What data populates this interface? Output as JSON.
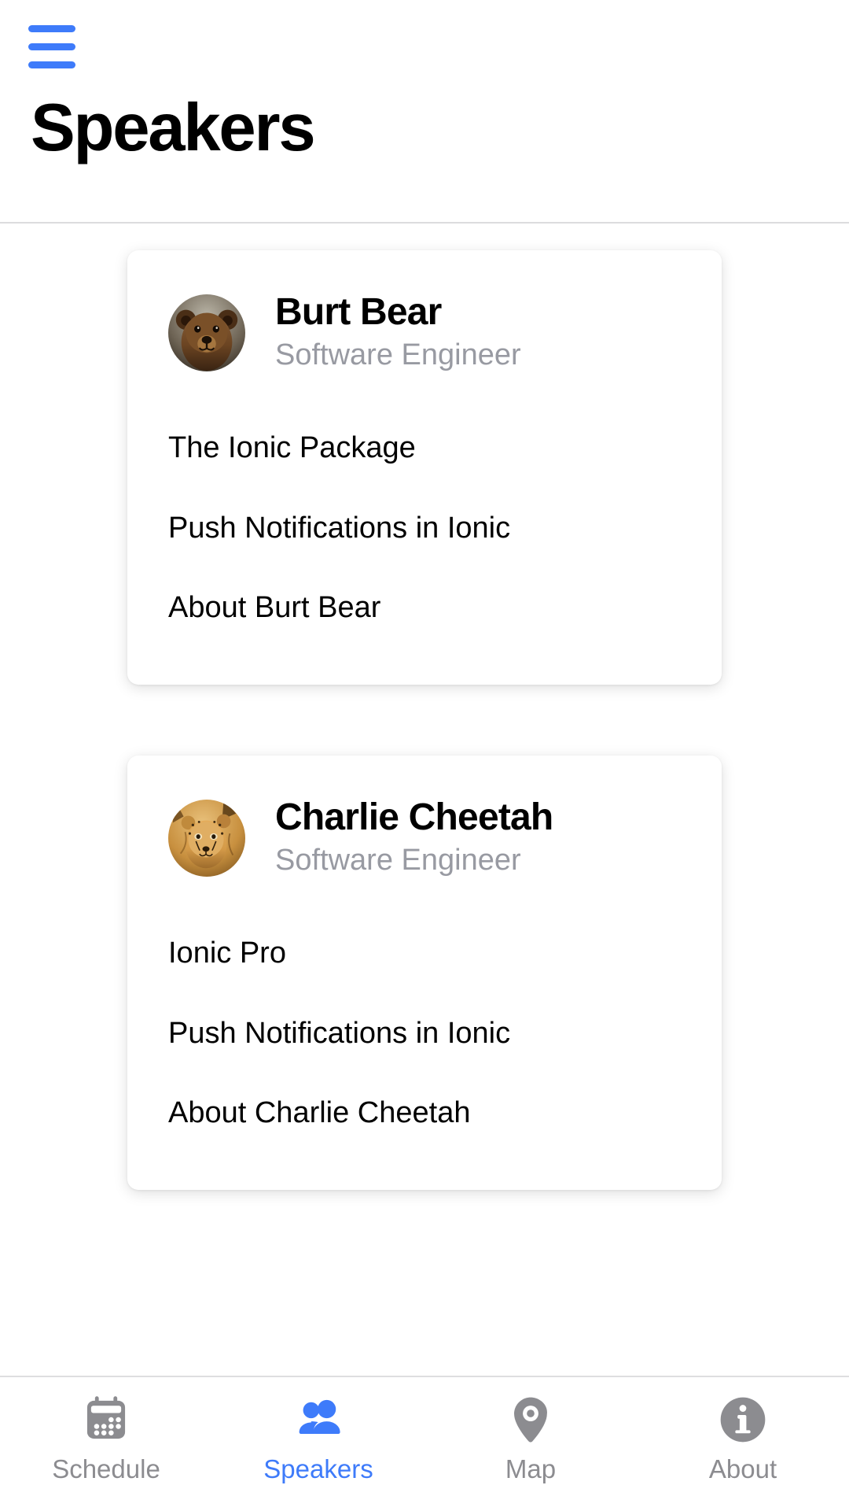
{
  "header": {
    "menu_icon": "hamburger-menu-icon",
    "title": "Speakers"
  },
  "theme": {
    "accent": "#3e7bfa",
    "inactive": "#8c8c90",
    "subtitle": "#989aa2",
    "text": "#000000",
    "card_bg": "#ffffff",
    "page_bg": "#ffffff"
  },
  "speakers": [
    {
      "name": "Burt Bear",
      "title": "Software Engineer",
      "avatar": "bear-avatar",
      "sessions": [
        "The Ionic Package",
        "Push Notifications in Ionic",
        "About Burt Bear"
      ]
    },
    {
      "name": "Charlie Cheetah",
      "title": "Software Engineer",
      "avatar": "cheetah-avatar",
      "sessions": [
        "Ionic Pro",
        "Push Notifications in Ionic",
        "About Charlie Cheetah"
      ]
    }
  ],
  "tabs": [
    {
      "label": "Schedule",
      "icon": "calendar-icon",
      "active": false
    },
    {
      "label": "Speakers",
      "icon": "people-icon",
      "active": true
    },
    {
      "label": "Map",
      "icon": "map-pin-icon",
      "active": false
    },
    {
      "label": "About",
      "icon": "info-circle-icon",
      "active": false
    }
  ]
}
